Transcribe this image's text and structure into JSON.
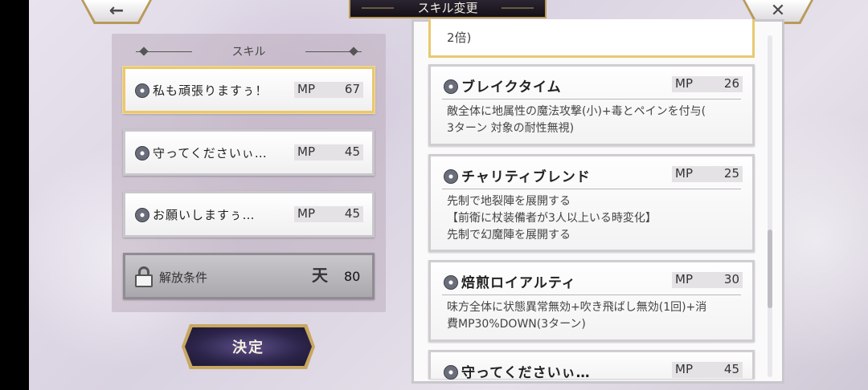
{
  "header": {
    "title": "スキル変更",
    "back_icon": "←",
    "close_icon": "✕"
  },
  "left_panel": {
    "title": "スキル",
    "slots": [
      {
        "name": "私も頑張りますぅ！",
        "mp_label": "MP",
        "mp": "67"
      },
      {
        "name": "守ってくださいぃ…",
        "mp_label": "MP",
        "mp": "45"
      },
      {
        "name": "お願いしますぅ…",
        "mp_label": "MP",
        "mp": "45"
      }
    ],
    "locked": {
      "label": "解放条件",
      "icon": "天",
      "value": "80"
    },
    "decide_label": "決定"
  },
  "right_panel": {
    "partial_text": "2倍)",
    "cards": [
      {
        "name": "ブレイクタイム",
        "mp_label": "MP",
        "mp": "26",
        "desc": [
          "敵全体に地属性の魔法攻撃(小)+毒とペインを付与(",
          "3ターン 対象の耐性無視)"
        ]
      },
      {
        "name": "チャリティブレンド",
        "mp_label": "MP",
        "mp": "25",
        "desc": [
          "先制で地裂陣を展開する",
          "【前衛に杖装備者が3人以上いる時変化】",
          "先制で幻魔陣を展開する"
        ]
      },
      {
        "name": "焙煎ロイアルティ",
        "mp_label": "MP",
        "mp": "30",
        "desc": [
          "味方全体に状態異常無効+吹き飛ばし無効(1回)+消",
          "費MP30%DOWN(3ターン)"
        ]
      },
      {
        "name": "守ってくださいぃ…",
        "mp_label": "MP",
        "mp": "45",
        "desc": []
      }
    ]
  },
  "colors": {
    "gold_border": "#e9c870",
    "frame_gold": "#b89a5a",
    "button_purple": "#3b3163"
  }
}
